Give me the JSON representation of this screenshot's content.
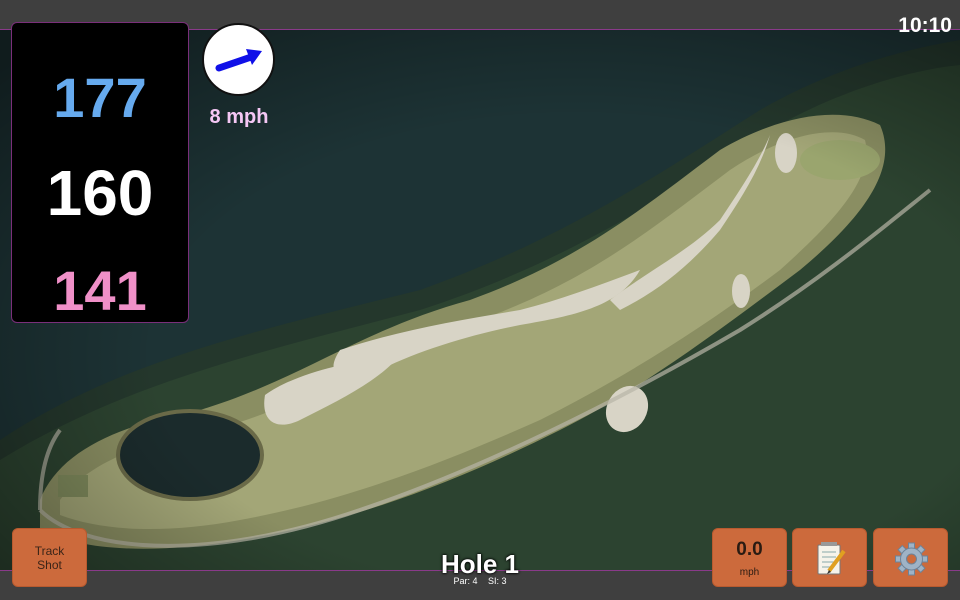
{
  "status": {
    "time": "10:10"
  },
  "distances": {
    "back": "177",
    "middle": "160",
    "front": "141"
  },
  "wind": {
    "speed": "8 mph",
    "icon": "wind-arrow-icon"
  },
  "hole": {
    "title": "Hole 1",
    "par": "Par: 4",
    "si": "SI: 3"
  },
  "buttons": {
    "track_shot": "Track Shot",
    "speed_value": "0.0",
    "speed_unit": "mph",
    "notes_icon": "notepad-icon",
    "settings_icon": "gear-icon"
  },
  "colors": {
    "back_distance": "#66aaee",
    "middle_distance": "#ffffff",
    "front_distance": "#f090c8",
    "wind_text": "#f5c7f5",
    "button": "#cc6a3c",
    "accent_border": "#8a3a8a"
  }
}
